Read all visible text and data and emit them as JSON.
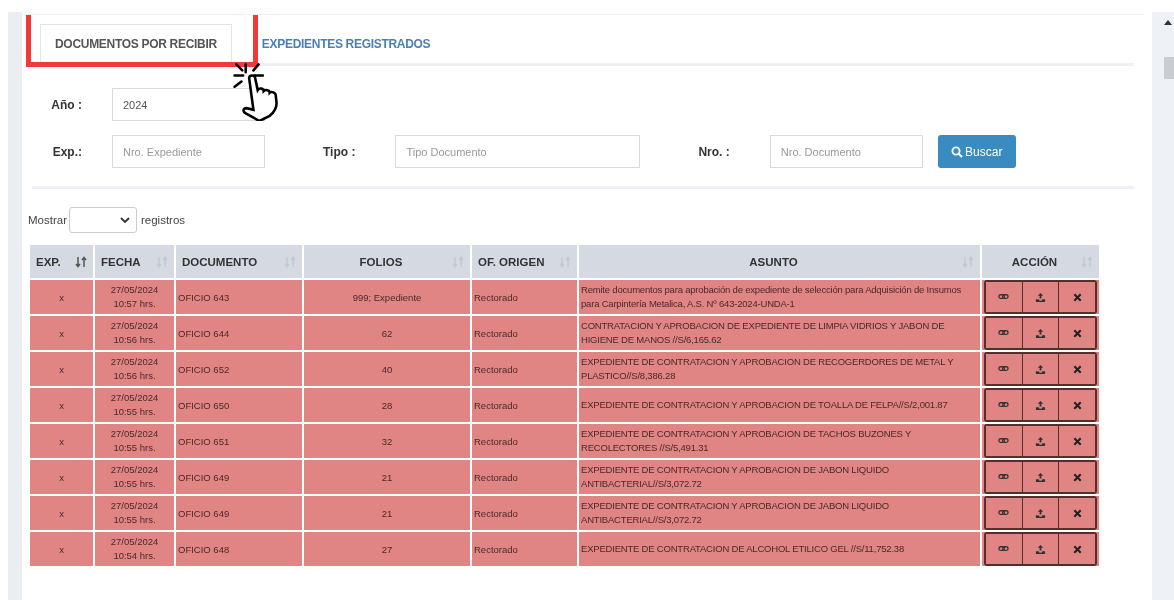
{
  "tabs": [
    {
      "label": "DOCUMENTOS POR RECIBIR",
      "selected": true
    },
    {
      "label": "EXPEDIENTES REGISTRADOS",
      "selected": false
    }
  ],
  "filters": {
    "year": {
      "label": "Año :",
      "value": "2024"
    },
    "fields": [
      {
        "label": "Exp.:",
        "placeholder": "Nro. Expediente"
      },
      {
        "label": "Tipo :",
        "placeholder": "Tipo Documento"
      },
      {
        "label": "Nro. :",
        "placeholder": "Nro. Documento"
      }
    ],
    "search_button": "Buscar"
  },
  "page_length": {
    "before": "Mostrar",
    "after": "registros"
  },
  "table": {
    "columns": [
      {
        "label": "EXP.",
        "sorted": true
      },
      {
        "label": "FECHA",
        "sorted": false
      },
      {
        "label": "DOCUMENTO",
        "sorted": false
      },
      {
        "label": "FOLIOS",
        "sorted": false
      },
      {
        "label": "OF. ORIGEN",
        "sorted": false
      },
      {
        "label": "ASUNTO",
        "sorted": false
      },
      {
        "label": "ACCIÓN",
        "sorted": false
      }
    ],
    "rows": [
      {
        "exp": "x",
        "date": "27/05/2024",
        "time": "10:57 hrs.",
        "document": "OFICIO 643",
        "folios": "999; Expediente",
        "origin": "Rectorado",
        "subject": "Remite documentos para aprobación de expediente de selección para Adquisición de Insumos para Carpintería Metalica, A.S. Nº 643-2024-UNDA-1"
      },
      {
        "exp": "x",
        "date": "27/05/2024",
        "time": "10:56 hrs.",
        "document": "OFICIO 644",
        "folios": "62",
        "origin": "Rectorado",
        "subject": "CONTRATACION Y APROBACION DE EXPEDIENTE DE LIMPIA VIDRIOS Y JABON DE HIGIENE DE MANOS //S/6,165.62"
      },
      {
        "exp": "x",
        "date": "27/05/2024",
        "time": "10:56 hrs.",
        "document": "OFICIO 652",
        "folios": "40",
        "origin": "Rectorado",
        "subject": "EXPEDIENTE DE CONTRATACION Y APROBACION DE RECOGERDORES DE METAL Y PLASTICO//S/8,386.28"
      },
      {
        "exp": "x",
        "date": "27/05/2024",
        "time": "10:55 hrs.",
        "document": "OFICIO 650",
        "folios": "28",
        "origin": "Rectorado",
        "subject": "EXPEDIENTE DE CONTRATACION Y APROBACION DE TOALLA DE FELPA//S/2,001.87"
      },
      {
        "exp": "x",
        "date": "27/05/2024",
        "time": "10:55 hrs.",
        "document": "OFICIO 651",
        "folios": "32",
        "origin": "Rectorado",
        "subject": "EXPEDIENTE DE CONTRATACION Y APROBACION DE TACHOS BUZONES Y RECOLECTORES //S/5,491.31"
      },
      {
        "exp": "x",
        "date": "27/05/2024",
        "time": "10:55 hrs.",
        "document": "OFICIO 649",
        "folios": "21",
        "origin": "Rectorado",
        "subject": "EXPEDIENTE DE CONTRATACION Y APROBACION DE JABON LIQUIDO ANTIBACTERIAL//S/3,072.72"
      },
      {
        "exp": "x",
        "date": "27/05/2024",
        "time": "10:55 hrs.",
        "document": "OFICIO 649",
        "folios": "21",
        "origin": "Rectorado",
        "subject": "EXPEDIENTE DE CONTRATACION Y APROBACION DE JABON LIQUIDO ANTIBACTERIAL//S/3,072.72"
      },
      {
        "exp": "x",
        "date": "27/05/2024",
        "time": "10:54 hrs.",
        "document": "OFICIO 648",
        "folios": "27",
        "origin": "Rectorado",
        "subject": "EXPEDIENTE DE CONTRATACION DE ALCOHOL ETILICO GEL //S/11,752.38"
      }
    ]
  }
}
